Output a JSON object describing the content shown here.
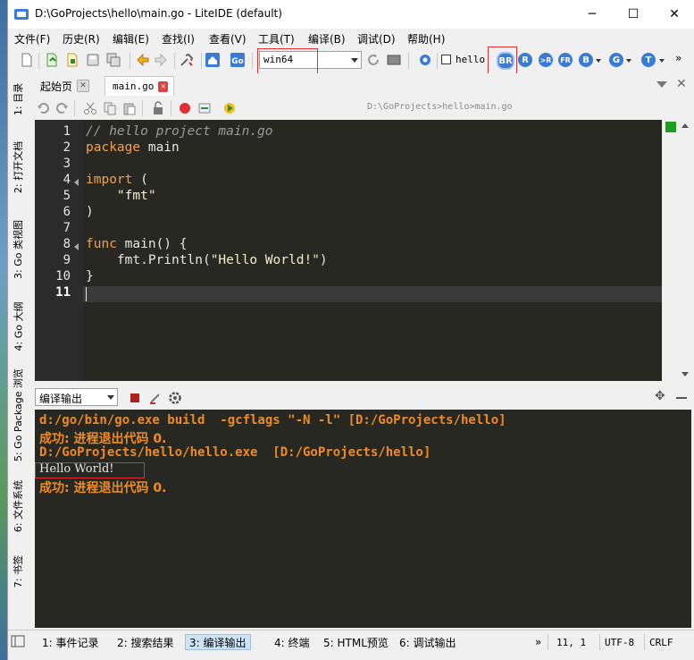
{
  "window": {
    "title": "D:\\GoProjects\\hello\\main.go - LiteIDE (default)"
  },
  "menu": [
    "文件(F)",
    "历史(R)",
    "编辑(E)",
    "查找(I)",
    "查看(V)",
    "工具(T)",
    "编译(B)",
    "调试(D)",
    "帮助(H)"
  ],
  "toolbar": {
    "env_value": "win64",
    "target_checkbox_label": "hello",
    "build_buttons": [
      "BR",
      "R",
      ">R",
      "FR",
      "B",
      "G",
      "T"
    ]
  },
  "sidebar_tabs": [
    "1: 目录",
    "2: 打开文档",
    "3: Go 类视图",
    "4: Go 大纲",
    "5: Go Package 浏览",
    "6: 文件系统",
    "7: 书签"
  ],
  "tabs": [
    {
      "label": "起始页"
    },
    {
      "label": "main.go"
    }
  ],
  "editor": {
    "path": "D:\\GoProjects>hello>main.go",
    "line_numbers": [
      "1",
      "2",
      "3",
      "4",
      "5",
      "6",
      "7",
      "8",
      "9",
      "10",
      "11"
    ]
  },
  "output": {
    "selector_value": "编译输出",
    "lines": [
      "d:/go/bin/go.exe build  -gcflags \"-N -l\" [D:/GoProjects/hello]",
      "成功: 进程退出代码 0.",
      "D:/GoProjects/hello/hello.exe  [D:/GoProjects/hello]",
      "Hello World!",
      "成功: 进程退出代码 0."
    ]
  },
  "statusbar": {
    "tabs": [
      "1: 事件记录",
      "2: 搜索结果",
      "3: 编译输出",
      "4: 终端",
      "5: HTML预览",
      "6: 调试输出"
    ],
    "more": "»",
    "position": "11,  1",
    "encoding": "UTF-8",
    "line_ending": "CRLF"
  },
  "colors": {
    "editor_bg": "#272822",
    "keyword": "#f0a050",
    "comment": "#9a9a9a",
    "string": "#f5ecc8",
    "output_orange": "#f08a24",
    "highlight_box": "#e03030"
  }
}
